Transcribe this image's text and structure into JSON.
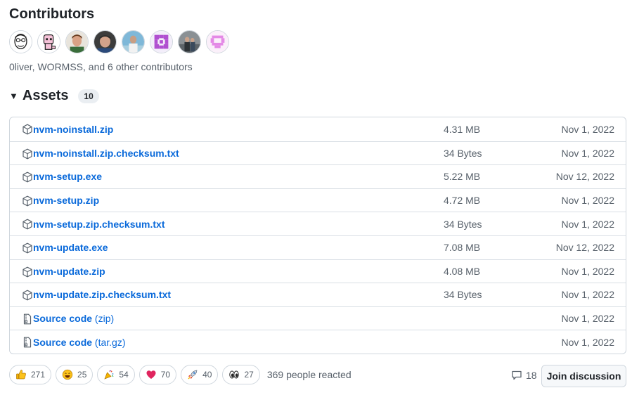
{
  "contributors": {
    "title": "Contributors",
    "summary": "0liver, WORMSS, and 6 other contributors",
    "avatars": [
      {
        "name": "avatar-1",
        "kind": "sketch-face"
      },
      {
        "name": "avatar-2",
        "kind": "pink-pixel"
      },
      {
        "name": "avatar-3",
        "kind": "photo"
      },
      {
        "name": "avatar-4",
        "kind": "photo"
      },
      {
        "name": "avatar-5",
        "kind": "photo"
      },
      {
        "name": "avatar-6",
        "kind": "identicon-purple"
      },
      {
        "name": "avatar-7",
        "kind": "photo"
      },
      {
        "name": "avatar-8",
        "kind": "identicon-pink"
      }
    ]
  },
  "assets": {
    "title": "Assets",
    "count": "10",
    "rows": [
      {
        "name": "nvm-noinstall.zip",
        "ext": "",
        "size": "4.31 MB",
        "date": "Nov 1, 2022",
        "icon": "package-icon"
      },
      {
        "name": "nvm-noinstall.zip.checksum.txt",
        "ext": "",
        "size": "34 Bytes",
        "date": "Nov 1, 2022",
        "icon": "package-icon"
      },
      {
        "name": "nvm-setup.exe",
        "ext": "",
        "size": "5.22 MB",
        "date": "Nov 12, 2022",
        "icon": "package-icon"
      },
      {
        "name": "nvm-setup.zip",
        "ext": "",
        "size": "4.72 MB",
        "date": "Nov 1, 2022",
        "icon": "package-icon"
      },
      {
        "name": "nvm-setup.zip.checksum.txt",
        "ext": "",
        "size": "34 Bytes",
        "date": "Nov 1, 2022",
        "icon": "package-icon"
      },
      {
        "name": "nvm-update.exe",
        "ext": "",
        "size": "7.08 MB",
        "date": "Nov 12, 2022",
        "icon": "package-icon"
      },
      {
        "name": "nvm-update.zip",
        "ext": "",
        "size": "4.08 MB",
        "date": "Nov 1, 2022",
        "icon": "package-icon"
      },
      {
        "name": "nvm-update.zip.checksum.txt",
        "ext": "",
        "size": "34 Bytes",
        "date": "Nov 1, 2022",
        "icon": "package-icon"
      },
      {
        "name": "Source code",
        "ext": " (zip)",
        "size": "",
        "date": "Nov 1, 2022",
        "icon": "file-zip-icon"
      },
      {
        "name": "Source code",
        "ext": " (tar.gz)",
        "size": "",
        "date": "Nov 1, 2022",
        "icon": "file-zip-icon"
      }
    ]
  },
  "reactions": {
    "items": [
      {
        "icon": "thumbs-up-icon",
        "count": "271"
      },
      {
        "icon": "laugh-icon",
        "count": "25"
      },
      {
        "icon": "hooray-icon",
        "count": "54"
      },
      {
        "icon": "heart-icon",
        "count": "70"
      },
      {
        "icon": "rocket-icon",
        "count": "40"
      },
      {
        "icon": "eyes-icon",
        "count": "27"
      }
    ],
    "summary": "369 people reacted"
  },
  "discussion": {
    "comment_count": "18",
    "join_label": "Join discussion"
  },
  "colors": {
    "link": "#0969da",
    "muted": "#57606a",
    "border": "#d0d7de"
  }
}
